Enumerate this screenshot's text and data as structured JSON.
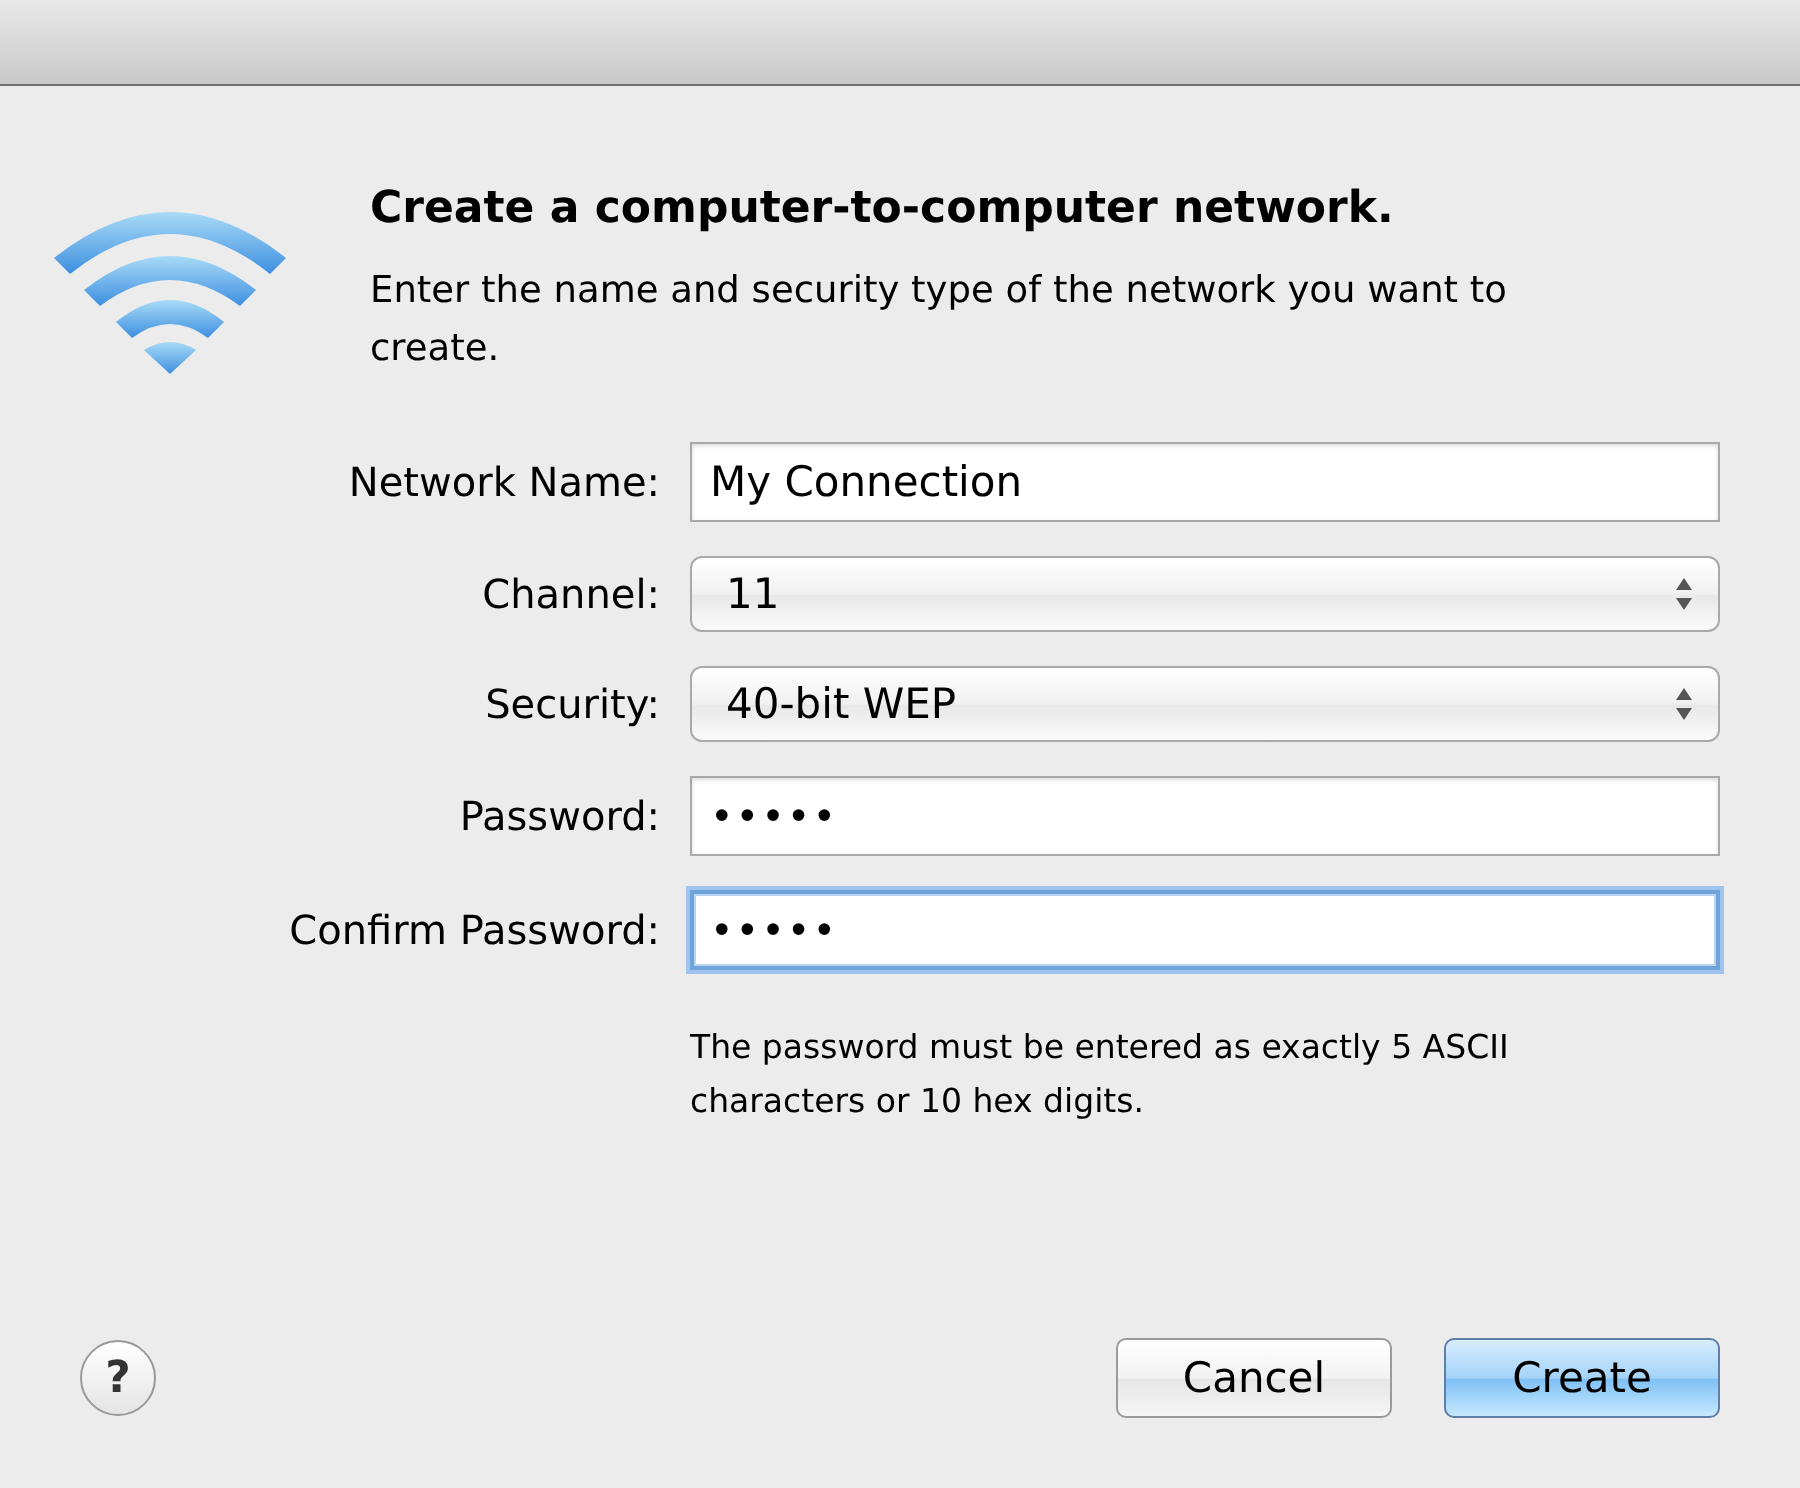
{
  "dialog": {
    "title": "Create a computer-to-computer network.",
    "description": "Enter the name and security type of the network you want to create."
  },
  "fields": [
    {
      "label": "Network Name:",
      "kind": "text",
      "value": "My Connection",
      "focused": false
    },
    {
      "label": "Channel:",
      "kind": "select",
      "value": "11"
    },
    {
      "label": "Security:",
      "kind": "select",
      "value": "40-bit WEP"
    },
    {
      "label": "Password:",
      "kind": "password",
      "value": "•••••",
      "focused": false
    },
    {
      "label": "Confirm Password:",
      "kind": "password",
      "value": "•••••",
      "focused": true
    }
  ],
  "hint": "The password must be entered as exactly 5 ASCII characters or 10 hex digits.",
  "help_button": "?",
  "buttons": [
    {
      "label": "Cancel",
      "default": false
    },
    {
      "label": "Create",
      "default": true
    }
  ]
}
